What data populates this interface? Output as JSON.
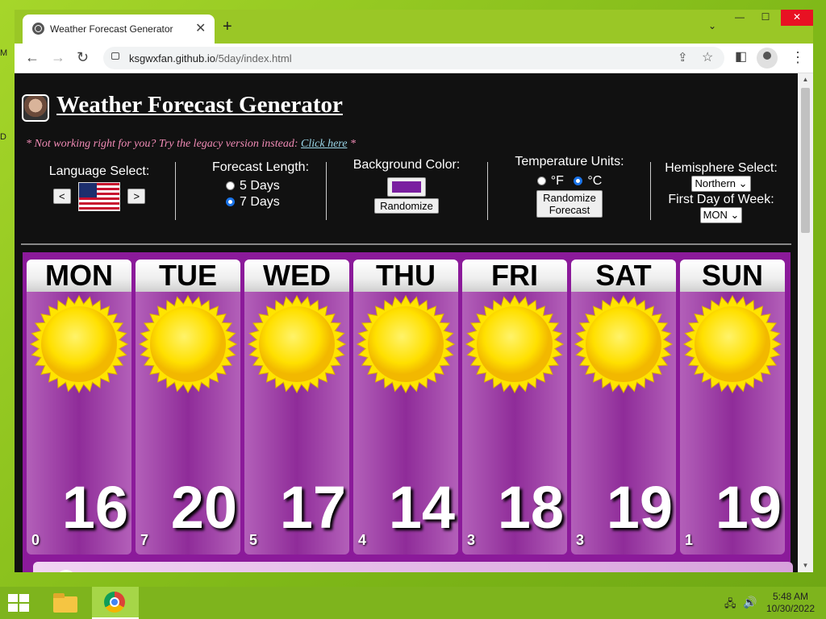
{
  "desktop": {
    "icon_labels": [
      "M",
      "D"
    ]
  },
  "browser": {
    "tab_title": "Weather Forecast Generator",
    "tab_close": "✕",
    "new_tab": "+",
    "tab_menu": "⌄",
    "win_min": "—",
    "win_max": "☐",
    "win_close": "✕",
    "url_host": "ksgwxfan.github.io",
    "url_path": "/5day/index.html",
    "back_glyph": "←",
    "forward_glyph": "→",
    "reload_glyph": "↻",
    "menu_glyph": "⋮",
    "share_glyph": "⇪",
    "star_glyph": "☆",
    "sidepanel_glyph": "◧"
  },
  "page": {
    "title": "Weather Forecast Generator",
    "legacy_text": "* Not working right for you? Try the legacy version instead: ",
    "legacy_link": "Click here",
    "legacy_end": " *",
    "language": {
      "label": "Language Select:",
      "prev": "<",
      "next": ">"
    },
    "forecast_length": {
      "label": "Forecast Length:",
      "option_5": "5 Days",
      "option_7": "7 Days",
      "selected": "7 Days"
    },
    "background_color": {
      "label": "Background Color:",
      "swatch": "#7a1fa0",
      "randomize": "Randomize"
    },
    "temperature_units": {
      "label": "Temperature Units:",
      "f": "°F",
      "c": "°C",
      "selected": "°C",
      "randomize": "Randomize Forecast"
    },
    "hemisphere": {
      "label": "Hemisphere Select:",
      "value": "Northern"
    },
    "first_day": {
      "label": "First Day of Week:",
      "value": "MON"
    }
  },
  "forecast": {
    "days": [
      {
        "name": "MON",
        "high": "16",
        "low": "0"
      },
      {
        "name": "TUE",
        "high": "20",
        "low": "7"
      },
      {
        "name": "WED",
        "high": "17",
        "low": "5"
      },
      {
        "name": "THU",
        "high": "14",
        "low": "4"
      },
      {
        "name": "FRI",
        "high": "18",
        "low": "3"
      },
      {
        "name": "SAT",
        "high": "19",
        "low": "3"
      },
      {
        "name": "SUN",
        "high": "19",
        "low": "1"
      }
    ],
    "condition_icon": "sun-icon"
  },
  "taskbar": {
    "time": "5:48 AM",
    "date": "10/30/2022"
  },
  "colors": {
    "accent": "#8b1a9a",
    "desktop": "#8dc21f",
    "sun": "#ffe000"
  }
}
